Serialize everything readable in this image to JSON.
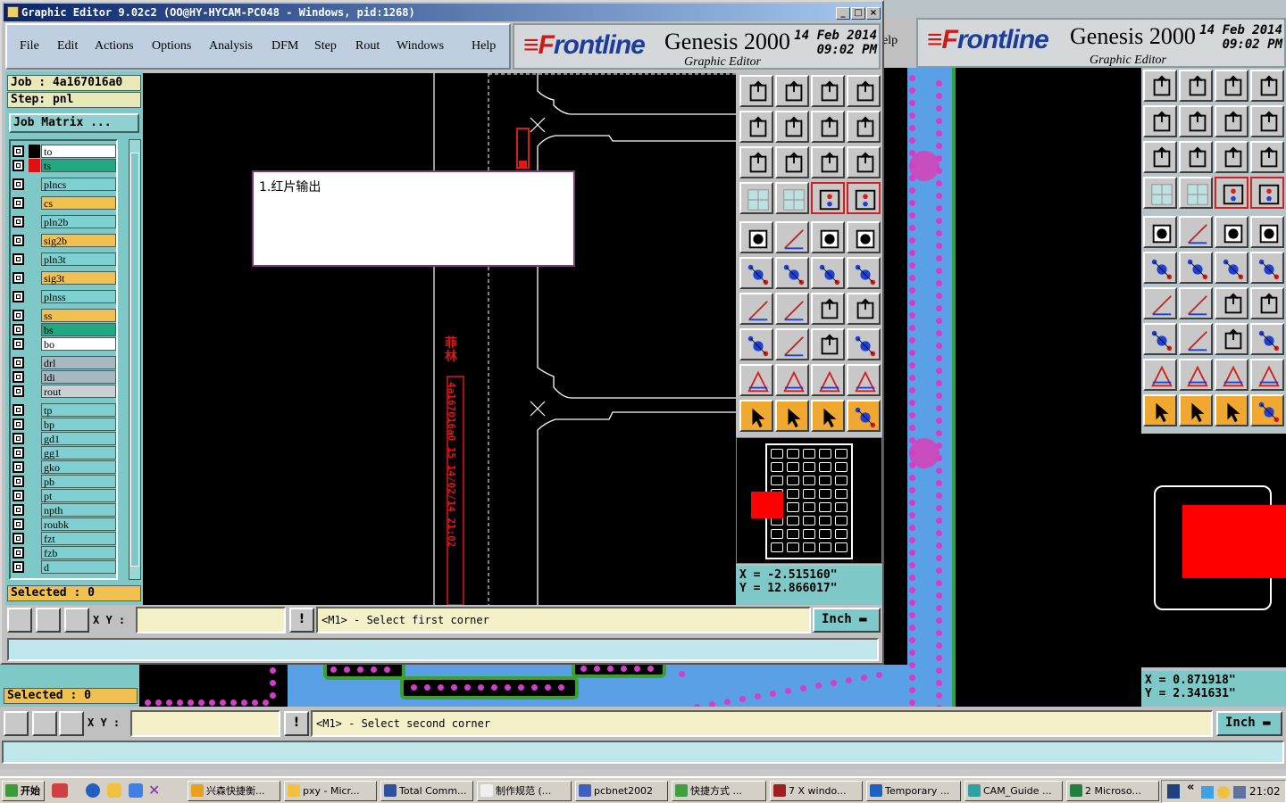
{
  "window": {
    "title": "Graphic Editor 9.02c2  (OO@HY-HYCAM-PC048 - Windows, pid:1268)",
    "minimize_glyph": "_",
    "maximize_glyph": "□",
    "close_glyph": "×"
  },
  "menu": {
    "file": "File",
    "edit": "Edit",
    "actions": "Actions",
    "options": "Options",
    "analysis": "Analysis",
    "dfm": "DFM",
    "step": "Step",
    "rout": "Rout",
    "windows": "Windows",
    "help": "Help"
  },
  "bg_menu": {
    "help_fragment": "elp"
  },
  "brand": {
    "logo_prefix": "≡F",
    "logo_rest": "rontline",
    "product": "Genesis 2000",
    "subtitle": "Graphic Editor",
    "date": "14 Feb 2014",
    "time": "09:02 PM"
  },
  "job": {
    "job_label": "Job : 4a167016a0",
    "step_label": "Step: pnl",
    "job_matrix": "Job Matrix ...",
    "selected": "Selected : 0"
  },
  "bg_panel": {
    "selected": "Selected : 0"
  },
  "layers": [
    {
      "name": "to",
      "color": "#ffffff",
      "swatch": "#000000"
    },
    {
      "name": "ts",
      "color": "#20a880",
      "swatch": "#e01010",
      "active": true
    },
    {
      "name": "plncs",
      "color": "#7fd0d0",
      "swatch": "#7fc8c8"
    },
    {
      "name": "cs",
      "color": "#f0c050",
      "swatch": "#7fc8c8"
    },
    {
      "name": "pln2b",
      "color": "#7fd0d0",
      "swatch": "#7fc8c8"
    },
    {
      "name": "sig2b",
      "color": "#f0c050",
      "swatch": "#7fc8c8"
    },
    {
      "name": "pln3t",
      "color": "#7fd0d0",
      "swatch": "#7fc8c8"
    },
    {
      "name": "sig3t",
      "color": "#f0c050",
      "swatch": "#7fc8c8"
    },
    {
      "name": "plnss",
      "color": "#7fd0d0",
      "swatch": "#7fc8c8"
    },
    {
      "name": "ss",
      "color": "#f0c050",
      "swatch": "#7fc8c8"
    },
    {
      "name": "bs",
      "color": "#20a880",
      "swatch": "#7fc8c8"
    },
    {
      "name": "bo",
      "color": "#ffffff",
      "swatch": "#7fc8c8"
    },
    {
      "name": "drl",
      "color": "#a8b8c0",
      "swatch": "#7fc8c8"
    },
    {
      "name": "ldi",
      "color": "#a8b8c0",
      "swatch": "#7fc8c8"
    },
    {
      "name": "rout",
      "color": "#c8d0d4",
      "swatch": "#7fc8c8"
    },
    {
      "name": "tp",
      "color": "#7fd0d0",
      "swatch": "#7fc8c8"
    },
    {
      "name": "bp",
      "color": "#7fd0d0",
      "swatch": "#7fc8c8"
    },
    {
      "name": "gd1",
      "color": "#7fd0d0",
      "swatch": "#7fc8c8"
    },
    {
      "name": "gg1",
      "color": "#7fd0d0",
      "swatch": "#7fc8c8"
    },
    {
      "name": "gko",
      "color": "#7fd0d0",
      "swatch": "#7fc8c8"
    },
    {
      "name": "pb",
      "color": "#7fd0d0",
      "swatch": "#7fc8c8"
    },
    {
      "name": "pt",
      "color": "#7fd0d0",
      "swatch": "#7fc8c8"
    },
    {
      "name": "npth",
      "color": "#7fd0d0",
      "swatch": "#7fc8c8"
    },
    {
      "name": "roubk",
      "color": "#7fd0d0",
      "swatch": "#7fc8c8"
    },
    {
      "name": "fzt",
      "color": "#7fd0d0",
      "swatch": "#7fc8c8"
    },
    {
      "name": "fzb",
      "color": "#7fd0d0",
      "swatch": "#7fc8c8"
    },
    {
      "name": "d",
      "color": "#7fd0d0",
      "swatch": "#7fc8c8"
    }
  ],
  "canvas": {
    "popup_text": "1.红片输出",
    "vertical_text": "4a167016a0 15 14/02/14 21:02",
    "vertical_heading": "菲林"
  },
  "main_status": {
    "xy_label": "X Y :",
    "xy_value": "",
    "bang": "!",
    "message": "<M1> - Select first corner",
    "units": "Inch"
  },
  "main_coords": {
    "x": "X  = -2.515160\"",
    "y": "Y  = 12.866017\""
  },
  "bg_status": {
    "xy_label": "X Y :",
    "xy_value": "",
    "bang": "!",
    "message": "<M1> - Select second corner",
    "units": "Inch"
  },
  "bg_coords": {
    "x": "X  = 0.871918\"",
    "y": "Y  = 2.341631\""
  },
  "colors": {
    "layer_active_swatch": "#e01010",
    "pcb_blue": "#5aa0e6",
    "pad_magenta": "#d23ec8"
  },
  "taskbar": {
    "start": "开始",
    "items": [
      {
        "label": "兴森快捷衡...",
        "icon_color": "#e8a020"
      },
      {
        "label": "pxy - Micr...",
        "icon_color": "#f0c040"
      },
      {
        "label": "Total Comm...",
        "icon_color": "#3050a0"
      },
      {
        "label": "制作规范 (...",
        "icon_color": "#f0f0f0"
      },
      {
        "label": "pcbnet2002",
        "icon_color": "#4060c0"
      },
      {
        "label": "快捷方式 ...",
        "icon_color": "#40a040"
      },
      {
        "label": "7 X windo...",
        "icon_color": "#a02020"
      },
      {
        "label": "Temporary ...",
        "icon_color": "#2060c0"
      },
      {
        "label": "CAM_Guide ...",
        "icon_color": "#30a0a0"
      },
      {
        "label": "2 Microso...",
        "icon_color": "#208040"
      }
    ],
    "clock": "21:02"
  }
}
